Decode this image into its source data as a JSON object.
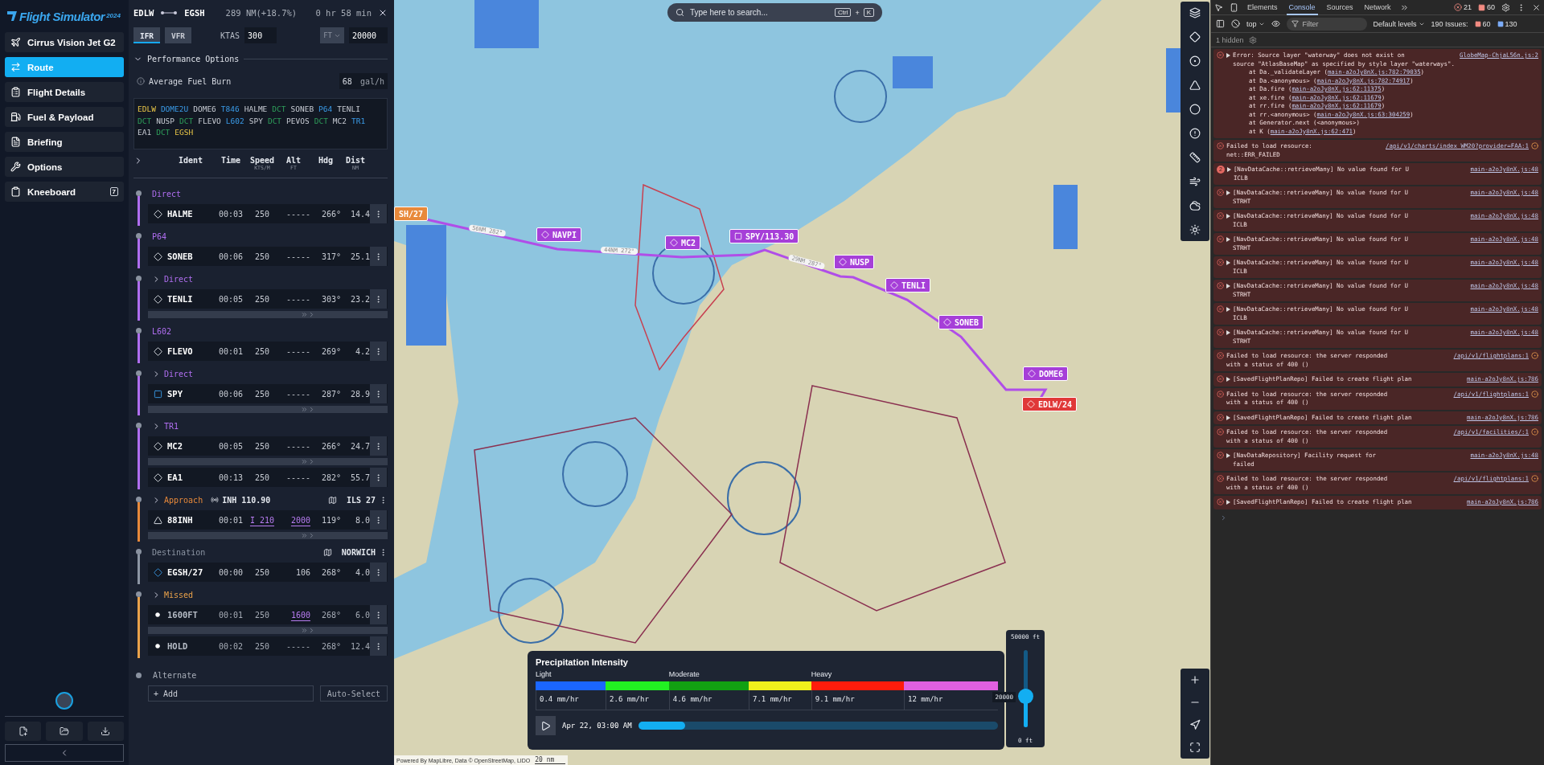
{
  "sidebar": {
    "logo": {
      "title": "Flight Simulator",
      "year": "2024"
    },
    "items": [
      {
        "label": "Cirrus Vision Jet G2",
        "selected": false
      },
      {
        "label": "Route",
        "selected": true
      },
      {
        "label": "Flight Details",
        "selected": false
      },
      {
        "label": "Fuel & Payload",
        "selected": false
      },
      {
        "label": "Briefing",
        "selected": false
      },
      {
        "label": "Options",
        "selected": false
      },
      {
        "label": "Kneeboard",
        "selected": false,
        "badge": "7"
      }
    ]
  },
  "flight_plan": {
    "origin": "EDLW",
    "destination": "EGSH",
    "distance": "289 NM(+18.7%)",
    "duration": "0 hr 58 min",
    "rules": [
      {
        "label": "IFR",
        "selected": true
      },
      {
        "label": "VFR",
        "selected": false
      }
    ],
    "speed": {
      "label": "KTAS",
      "value": "300"
    },
    "altitude": {
      "unit": "FT",
      "value": "20000"
    },
    "performance": {
      "title": "Performance Options",
      "expanded": true,
      "fuel_burn": {
        "label": "Average Fuel Burn",
        "value": "68",
        "unit": "gal/h"
      }
    },
    "route_string": [
      {
        "text": "EDLW",
        "kind": "airport"
      },
      {
        "text": "DOME2U",
        "kind": "procedure"
      },
      {
        "text": "DOME6",
        "kind": "fix"
      },
      {
        "text": "T846",
        "kind": "airway"
      },
      {
        "text": "HALME",
        "kind": "fix"
      },
      {
        "text": "DCT",
        "kind": "dct"
      },
      {
        "text": "SONEB",
        "kind": "fix"
      },
      {
        "text": "P64",
        "kind": "airway"
      },
      {
        "text": "TENLI",
        "kind": "fix"
      },
      {
        "text": "DCT",
        "kind": "dct"
      },
      {
        "text": "NUSP",
        "kind": "fix"
      },
      {
        "text": "DCT",
        "kind": "dct"
      },
      {
        "text": "FLEVO",
        "kind": "fix"
      },
      {
        "text": "L602",
        "kind": "airway"
      },
      {
        "text": "SPY",
        "kind": "fix"
      },
      {
        "text": "DCT",
        "kind": "dct"
      },
      {
        "text": "PEVOS",
        "kind": "fix"
      },
      {
        "text": "DCT",
        "kind": "dct"
      },
      {
        "text": "MC2",
        "kind": "fix"
      },
      {
        "text": "TR1",
        "kind": "airway"
      },
      {
        "text": "EA1",
        "kind": "fix"
      },
      {
        "text": "DCT",
        "kind": "dct"
      },
      {
        "text": "EGSH",
        "kind": "airport"
      }
    ],
    "columns": [
      {
        "label": "Ident"
      },
      {
        "label": "Time"
      },
      {
        "label": "Speed",
        "unit": "KTS/M"
      },
      {
        "label": "Alt",
        "unit": "FT"
      },
      {
        "label": "Hdg"
      },
      {
        "label": "Dist",
        "unit": "NM"
      }
    ],
    "groups": [
      {
        "title": "Direct",
        "expandable": false,
        "color": "#b06ef0",
        "legs": [
          {
            "kind": "waypoint",
            "ident": "HALME",
            "time": "00:03",
            "speed": "250",
            "speed_constrained": false,
            "alt": "-----",
            "alt_constrained": false,
            "hdg": "266°",
            "dist": "14.4"
          }
        ]
      },
      {
        "title": "P64",
        "expandable": false,
        "color": "#b06ef0",
        "legs": [
          {
            "kind": "waypoint",
            "ident": "SONEB",
            "time": "00:06",
            "speed": "250",
            "speed_constrained": false,
            "alt": "-----",
            "alt_constrained": false,
            "hdg": "317°",
            "dist": "25.1"
          }
        ]
      },
      {
        "title": "Direct",
        "expandable": true,
        "color": "#b06ef0",
        "legs": [
          {
            "kind": "waypoint",
            "ident": "TENLI",
            "time": "00:05",
            "speed": "250",
            "speed_constrained": false,
            "alt": "-----",
            "alt_constrained": false,
            "hdg": "303°",
            "dist": "23.2"
          },
          {
            "kind": "collapsed"
          }
        ]
      },
      {
        "title": "L602",
        "expandable": false,
        "color": "#b06ef0",
        "legs": [
          {
            "kind": "waypoint",
            "ident": "FLEVO",
            "time": "00:01",
            "speed": "250",
            "speed_constrained": false,
            "alt": "-----",
            "alt_constrained": false,
            "hdg": "269°",
            "dist": "4.2"
          }
        ]
      },
      {
        "title": "Direct",
        "expandable": true,
        "color": "#b06ef0",
        "legs": [
          {
            "kind": "vor",
            "ident": "SPY",
            "time": "00:06",
            "speed": "250",
            "speed_constrained": false,
            "alt": "-----",
            "alt_constrained": false,
            "hdg": "287°",
            "dist": "28.9"
          },
          {
            "kind": "collapsed"
          }
        ]
      },
      {
        "title": "TR1",
        "expandable": true,
        "color": "#b06ef0",
        "legs": [
          {
            "kind": "waypoint",
            "ident": "MC2",
            "time": "00:05",
            "speed": "250",
            "speed_constrained": false,
            "alt": "-----",
            "alt_constrained": false,
            "hdg": "266°",
            "dist": "24.7"
          },
          {
            "kind": "collapsed"
          },
          {
            "kind": "waypoint",
            "ident": "EA1",
            "time": "00:13",
            "speed": "250",
            "speed_constrained": false,
            "alt": "-----",
            "alt_constrained": false,
            "hdg": "282°",
            "dist": "55.7"
          }
        ]
      },
      {
        "title": "Approach",
        "expandable": true,
        "color": "#e8893a",
        "frequency": "INH 110.90",
        "chart": "ILS 27",
        "legs": [
          {
            "kind": "fix",
            "ident": "88INH",
            "time": "00:01",
            "speed": "I 210",
            "speed_constrained": true,
            "alt": "2000",
            "alt_constrained": true,
            "hdg": "119°",
            "dist": "8.0"
          },
          {
            "kind": "collapsed"
          }
        ]
      },
      {
        "title": "Destination",
        "expandable": false,
        "color": "#8d96a4",
        "chart": "NORWICH",
        "legs": [
          {
            "kind": "airport",
            "ident": "EGSH/27",
            "time": "00:00",
            "speed": "250",
            "speed_constrained": false,
            "alt": "106",
            "alt_constrained": false,
            "hdg": "268°",
            "dist": "4.0"
          }
        ]
      },
      {
        "title": "Missed",
        "expandable": true,
        "color": "#eaa24a",
        "legs": [
          {
            "kind": "dot",
            "ident": "1600FT",
            "time": "00:01",
            "speed": "250",
            "speed_constrained": false,
            "alt": "1600",
            "alt_constrained": true,
            "hdg": "268°",
            "dist": "6.0"
          },
          {
            "kind": "collapsed"
          },
          {
            "kind": "dot",
            "ident": "HOLD",
            "time": "00:02",
            "speed": "250",
            "speed_constrained": false,
            "alt": "-----",
            "alt_constrained": false,
            "hdg": "268°",
            "dist": "12.4"
          }
        ]
      }
    ],
    "alternate": {
      "title": "Alternate",
      "add": "+ Add",
      "auto": "Auto-Select"
    }
  },
  "map": {
    "search": {
      "placeholder": "Type here to search...",
      "keys": [
        "Ctrl",
        "+",
        "K"
      ]
    },
    "waypoints": [
      {
        "label": "SH/27",
        "kind": "airport",
        "color": "#e8893a"
      },
      {
        "label": "NAVPI",
        "kind": "waypoint",
        "color": "#a63fd8"
      },
      {
        "label": "MC2",
        "kind": "waypoint",
        "color": "#a63fd8"
      },
      {
        "label": "SPY/113.30",
        "kind": "vor",
        "color": "#a63fd8"
      },
      {
        "label": "NUSP",
        "kind": "waypoint",
        "color": "#a63fd8"
      },
      {
        "label": "TENLI",
        "kind": "waypoint",
        "color": "#a63fd8"
      },
      {
        "label": "SONEB",
        "kind": "waypoint",
        "color": "#a63fd8"
      },
      {
        "label": "DOME6",
        "kind": "waypoint",
        "color": "#a63fd8"
      },
      {
        "label": "EDLW/24",
        "kind": "waypoint",
        "color": "#e03838"
      }
    ],
    "leg_labels": [
      "56NM 282°",
      "44NM 272°",
      "29NM 287°"
    ],
    "attribution": "Powered By MapLibre, Data © OpenStreetMap, LIDO",
    "scale": "20 nm",
    "precipitation": {
      "title": "Precipitation Intensity",
      "levels": [
        "Light",
        "Moderate",
        "Heavy"
      ],
      "bands": [
        {
          "value": "0.4 mm/hr",
          "color": "#1b66ff"
        },
        {
          "value": "2.6 mm/hr",
          "color": "#22f022"
        },
        {
          "value": "4.6 mm/hr",
          "color": "#12a012"
        },
        {
          "value": "7.1 mm/hr",
          "color": "#f0f01c"
        },
        {
          "value": "9.1 mm/hr",
          "color": "#ff1c0c"
        },
        {
          "value": "12 mm/hr",
          "color": "#e060e0"
        }
      ],
      "time": "Apr 22, 03:00 AM",
      "level": 0.13
    },
    "altitude": {
      "max": "50000 ft",
      "min": "0 ft",
      "value": "20000",
      "level": 0.4
    }
  },
  "devtools": {
    "tabs": [
      {
        "label": "Elements",
        "selected": false
      },
      {
        "label": "Console",
        "selected": true
      },
      {
        "label": "Sources",
        "selected": false
      },
      {
        "label": "Network",
        "selected": false
      }
    ],
    "errors": "21",
    "warnings": "60",
    "context": "top",
    "filter_placeholder": "Filter",
    "levels": "Default levels",
    "issues": "190 Issues:",
    "issue_errors": "60",
    "issue_info": "130",
    "hidden": "1 hidden",
    "messages": [
      {
        "expandable": true,
        "network": false,
        "lines": [
          "Error: Source layer \"waterway\" does not exist on",
          "source \"AtlasBaseMap\" as specified by style layer \"waterways\"."
        ],
        "source": "GlobeMap-ChjaL56n.js:2",
        "stack": [
          {
            "before": "at Da._validateLayer (",
            "link": "main-a2oJy8nX.js:782:79035",
            "after": ")"
          },
          {
            "before": "at Da.<anonymous> (",
            "link": "main-a2oJy8nX.js:782:74917",
            "after": ")"
          },
          {
            "before": "at Da.fire (",
            "link": "main-a2oJy8nX.js:62:11375",
            "after": ")"
          },
          {
            "before": "at xe.fire (",
            "link": "main-a2oJy8nX.js:62:11679",
            "after": ")"
          },
          {
            "before": "at rr.fire (",
            "link": "main-a2oJy8nX.js:62:11679",
            "after": ")"
          },
          {
            "before": "at rr.<anonymous> (",
            "link": "main-a2oJy8nX.js:63:304259",
            "after": ")"
          },
          {
            "before": "at Generator.next (<anonymous>)"
          },
          {
            "before": "at K (",
            "link": "main-a2oJy8nX.js:62:471",
            "after": ")"
          }
        ]
      },
      {
        "expandable": false,
        "network": true,
        "lines": [
          "Failed to load resource:",
          "net::ERR_FAILED"
        ],
        "source": "/api/v1/charts/index_WM20?provider=FAA:1"
      },
      {
        "expandable": true,
        "network": false,
        "count": "2",
        "lines": [
          "[NavDataCache::retrieveMany] No value found for U",
          "ICLB"
        ],
        "source": "main-a2oJy8nX.js:48"
      },
      {
        "expandable": true,
        "network": false,
        "lines": [
          "[NavDataCache::retrieveMany] No value found for U",
          "STRHT"
        ],
        "source": "main-a2oJy8nX.js:48"
      },
      {
        "expandable": true,
        "network": false,
        "lines": [
          "[NavDataCache::retrieveMany] No value found for U",
          "ICLB"
        ],
        "source": "main-a2oJy8nX.js:48"
      },
      {
        "expandable": true,
        "network": false,
        "lines": [
          "[NavDataCache::retrieveMany] No value found for U",
          "STRHT"
        ],
        "source": "main-a2oJy8nX.js:48"
      },
      {
        "expandable": true,
        "network": false,
        "lines": [
          "[NavDataCache::retrieveMany] No value found for U",
          "ICLB"
        ],
        "source": "main-a2oJy8nX.js:48"
      },
      {
        "expandable": true,
        "network": false,
        "lines": [
          "[NavDataCache::retrieveMany] No value found for U",
          "STRHT"
        ],
        "source": "main-a2oJy8nX.js:48"
      },
      {
        "expandable": true,
        "network": false,
        "lines": [
          "[NavDataCache::retrieveMany] No value found for U",
          "ICLB"
        ],
        "source": "main-a2oJy8nX.js:48"
      },
      {
        "expandable": true,
        "network": false,
        "lines": [
          "[NavDataCache::retrieveMany] No value found for U",
          "STRHT"
        ],
        "source": "main-a2oJy8nX.js:48"
      },
      {
        "expandable": false,
        "network": true,
        "lines": [
          "Failed to load resource: the server responded",
          "with a status of 400 ()"
        ],
        "source": "/api/v1/flightplans:1"
      },
      {
        "expandable": true,
        "network": false,
        "lines": [
          "[SavedFlightPlanRepo] Failed to create flight plan"
        ],
        "source": "main-a2oJy8nX.js:786"
      },
      {
        "expandable": false,
        "network": true,
        "lines": [
          "Failed to load resource: the server responded",
          "with a status of 400 ()"
        ],
        "source": "/api/v1/flightplans:1"
      },
      {
        "expandable": true,
        "network": false,
        "lines": [
          "[SavedFlightPlanRepo] Failed to create flight plan"
        ],
        "source": "main-a2oJy8nX.js:786"
      },
      {
        "expandable": false,
        "network": true,
        "lines": [
          "Failed to load resource: the server responded",
          "with a status of 400 ()"
        ],
        "source": "/api/v1/facilities/:1"
      },
      {
        "expandable": true,
        "network": false,
        "lines": [
          "[NavDataRepository] Facility request for",
          "failed"
        ],
        "source": "main-a2oJy8nX.js:48"
      },
      {
        "expandable": false,
        "network": true,
        "lines": [
          "Failed to load resource: the server responded",
          "with a status of 400 ()"
        ],
        "source": "/api/v1/flightplans:1"
      },
      {
        "expandable": true,
        "network": false,
        "lines": [
          "[SavedFlightPlanRepo] Failed to create flight plan"
        ],
        "source": "main-a2oJy8nX.js:786"
      }
    ]
  }
}
